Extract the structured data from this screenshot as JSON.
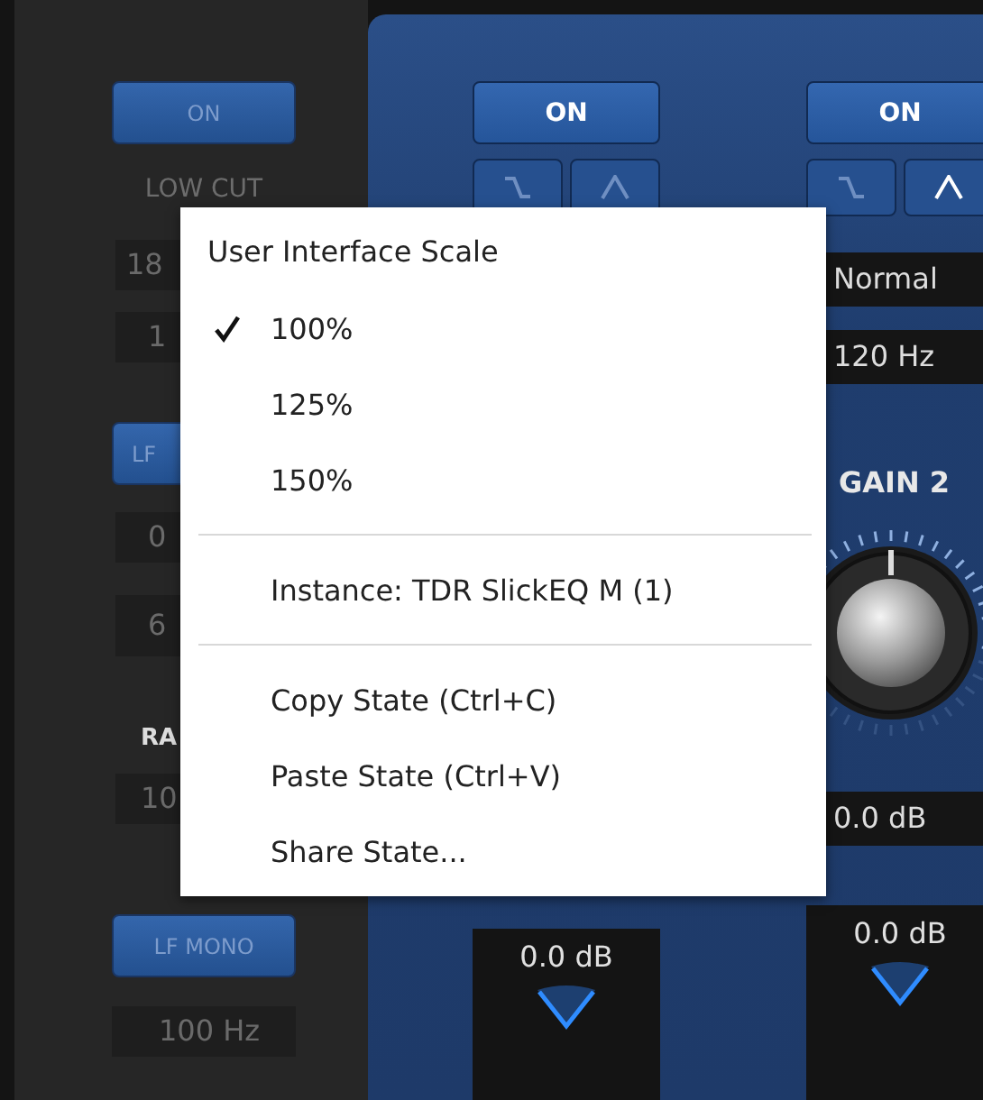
{
  "left_column": [
    {
      "kind": "button",
      "label": "ON",
      "on": true
    },
    {
      "kind": "label",
      "text": "LOW CUT"
    },
    {
      "kind": "field",
      "value": "18"
    },
    {
      "kind": "field",
      "value": "1"
    },
    {
      "kind": "button",
      "label": "LF",
      "on": true
    },
    {
      "kind": "field",
      "value": "0"
    },
    {
      "kind": "field",
      "value": "6"
    },
    {
      "kind": "label",
      "text": "RA"
    },
    {
      "kind": "field",
      "value": "10"
    },
    {
      "kind": "button",
      "label": "LF MONO",
      "on": true
    },
    {
      "kind": "field",
      "value": "100 Hz"
    }
  ],
  "bands": [
    {
      "on_button": {
        "label": "ON",
        "on": true
      },
      "filter_buttons": [
        {
          "kind": "shelf",
          "selected": false
        },
        {
          "kind": "bell",
          "selected": false
        }
      ],
      "output": "0.0 dB"
    },
    {
      "on_button": {
        "label": "ON",
        "on": true
      },
      "filter_buttons": [
        {
          "kind": "shelf",
          "selected": false
        },
        {
          "kind": "bell",
          "selected": true
        }
      ],
      "mode": "Normal",
      "frequency": "120 Hz",
      "gain_label": "GAIN 2",
      "gain": "0.0 dB",
      "output": "0.0 dB"
    }
  ],
  "context_menu": {
    "title": "User Interface Scale",
    "items": [
      {
        "kind": "option",
        "label": "100%",
        "checked": true
      },
      {
        "kind": "option",
        "label": "125%",
        "checked": false
      },
      {
        "kind": "option",
        "label": "150%",
        "checked": false
      },
      {
        "kind": "separator"
      },
      {
        "kind": "info",
        "label": "Instance: TDR SlickEQ M (1)"
      },
      {
        "kind": "separator"
      },
      {
        "kind": "action",
        "label": "Copy State (Ctrl+C)"
      },
      {
        "kind": "action",
        "label": "Paste State (Ctrl+V)"
      },
      {
        "kind": "action",
        "label": "Share State..."
      }
    ]
  }
}
